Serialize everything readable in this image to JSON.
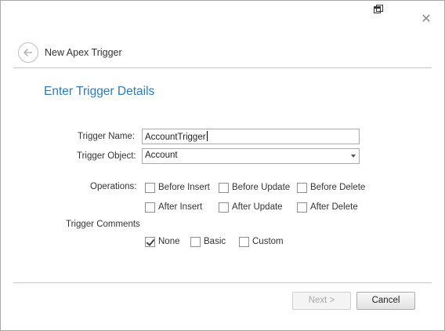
{
  "window": {
    "title": "New Apex Trigger"
  },
  "section": {
    "title": "Enter Trigger Details"
  },
  "form": {
    "trigger_name_label": "Trigger Name:",
    "trigger_name_value": "AccountTrigger",
    "trigger_object_label": "Trigger Object:",
    "trigger_object_value": "Account",
    "operations_label": "Operations:",
    "operations": [
      {
        "label": "Before Insert",
        "checked": false
      },
      {
        "label": "Before Update",
        "checked": false
      },
      {
        "label": "Before Delete",
        "checked": false
      },
      {
        "label": "After Insert",
        "checked": false
      },
      {
        "label": "After Update",
        "checked": false
      },
      {
        "label": "After Delete",
        "checked": false
      }
    ],
    "comments_label": "Trigger Comments",
    "comments": [
      {
        "label": "None",
        "checked": true
      },
      {
        "label": "Basic",
        "checked": false
      },
      {
        "label": "Custom",
        "checked": false
      }
    ]
  },
  "buttons": {
    "next": "Next >",
    "cancel": "Cancel",
    "next_enabled": false
  },
  "colors": {
    "accent": "#2e7ab8"
  }
}
